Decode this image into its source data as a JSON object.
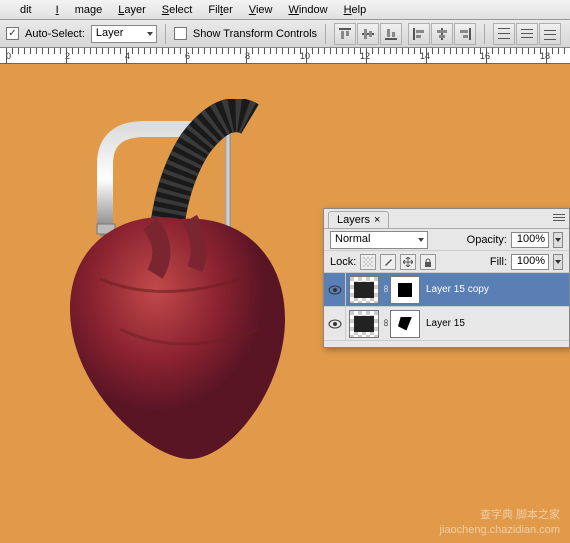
{
  "menu": {
    "edit": "dit",
    "image": "Image",
    "layer": "Layer",
    "select": "Select",
    "filter": "Filter",
    "view": "View",
    "window": "Window",
    "help": "Help"
  },
  "options": {
    "autoselect_label": "Auto-Select:",
    "autoselect_target": "Layer",
    "showtransform_label": "Show Transform Controls"
  },
  "ruler": {
    "ticks": [
      "0",
      "2",
      "4",
      "6",
      "8",
      "10",
      "12",
      "14",
      "16",
      "18"
    ]
  },
  "panel": {
    "tab": "Layers",
    "blend_mode": "Normal",
    "opacity_label": "Opacity:",
    "opacity_value": "100%",
    "lock_label": "Lock:",
    "fill_label": "Fill:",
    "fill_value": "100%",
    "layers": [
      {
        "name": "Layer 15 copy",
        "active": true
      },
      {
        "name": "Layer 15",
        "active": false
      }
    ]
  },
  "watermark": {
    "line1": "查字典 脚本之家",
    "line2": "jiaocheng.chazidian.com"
  }
}
